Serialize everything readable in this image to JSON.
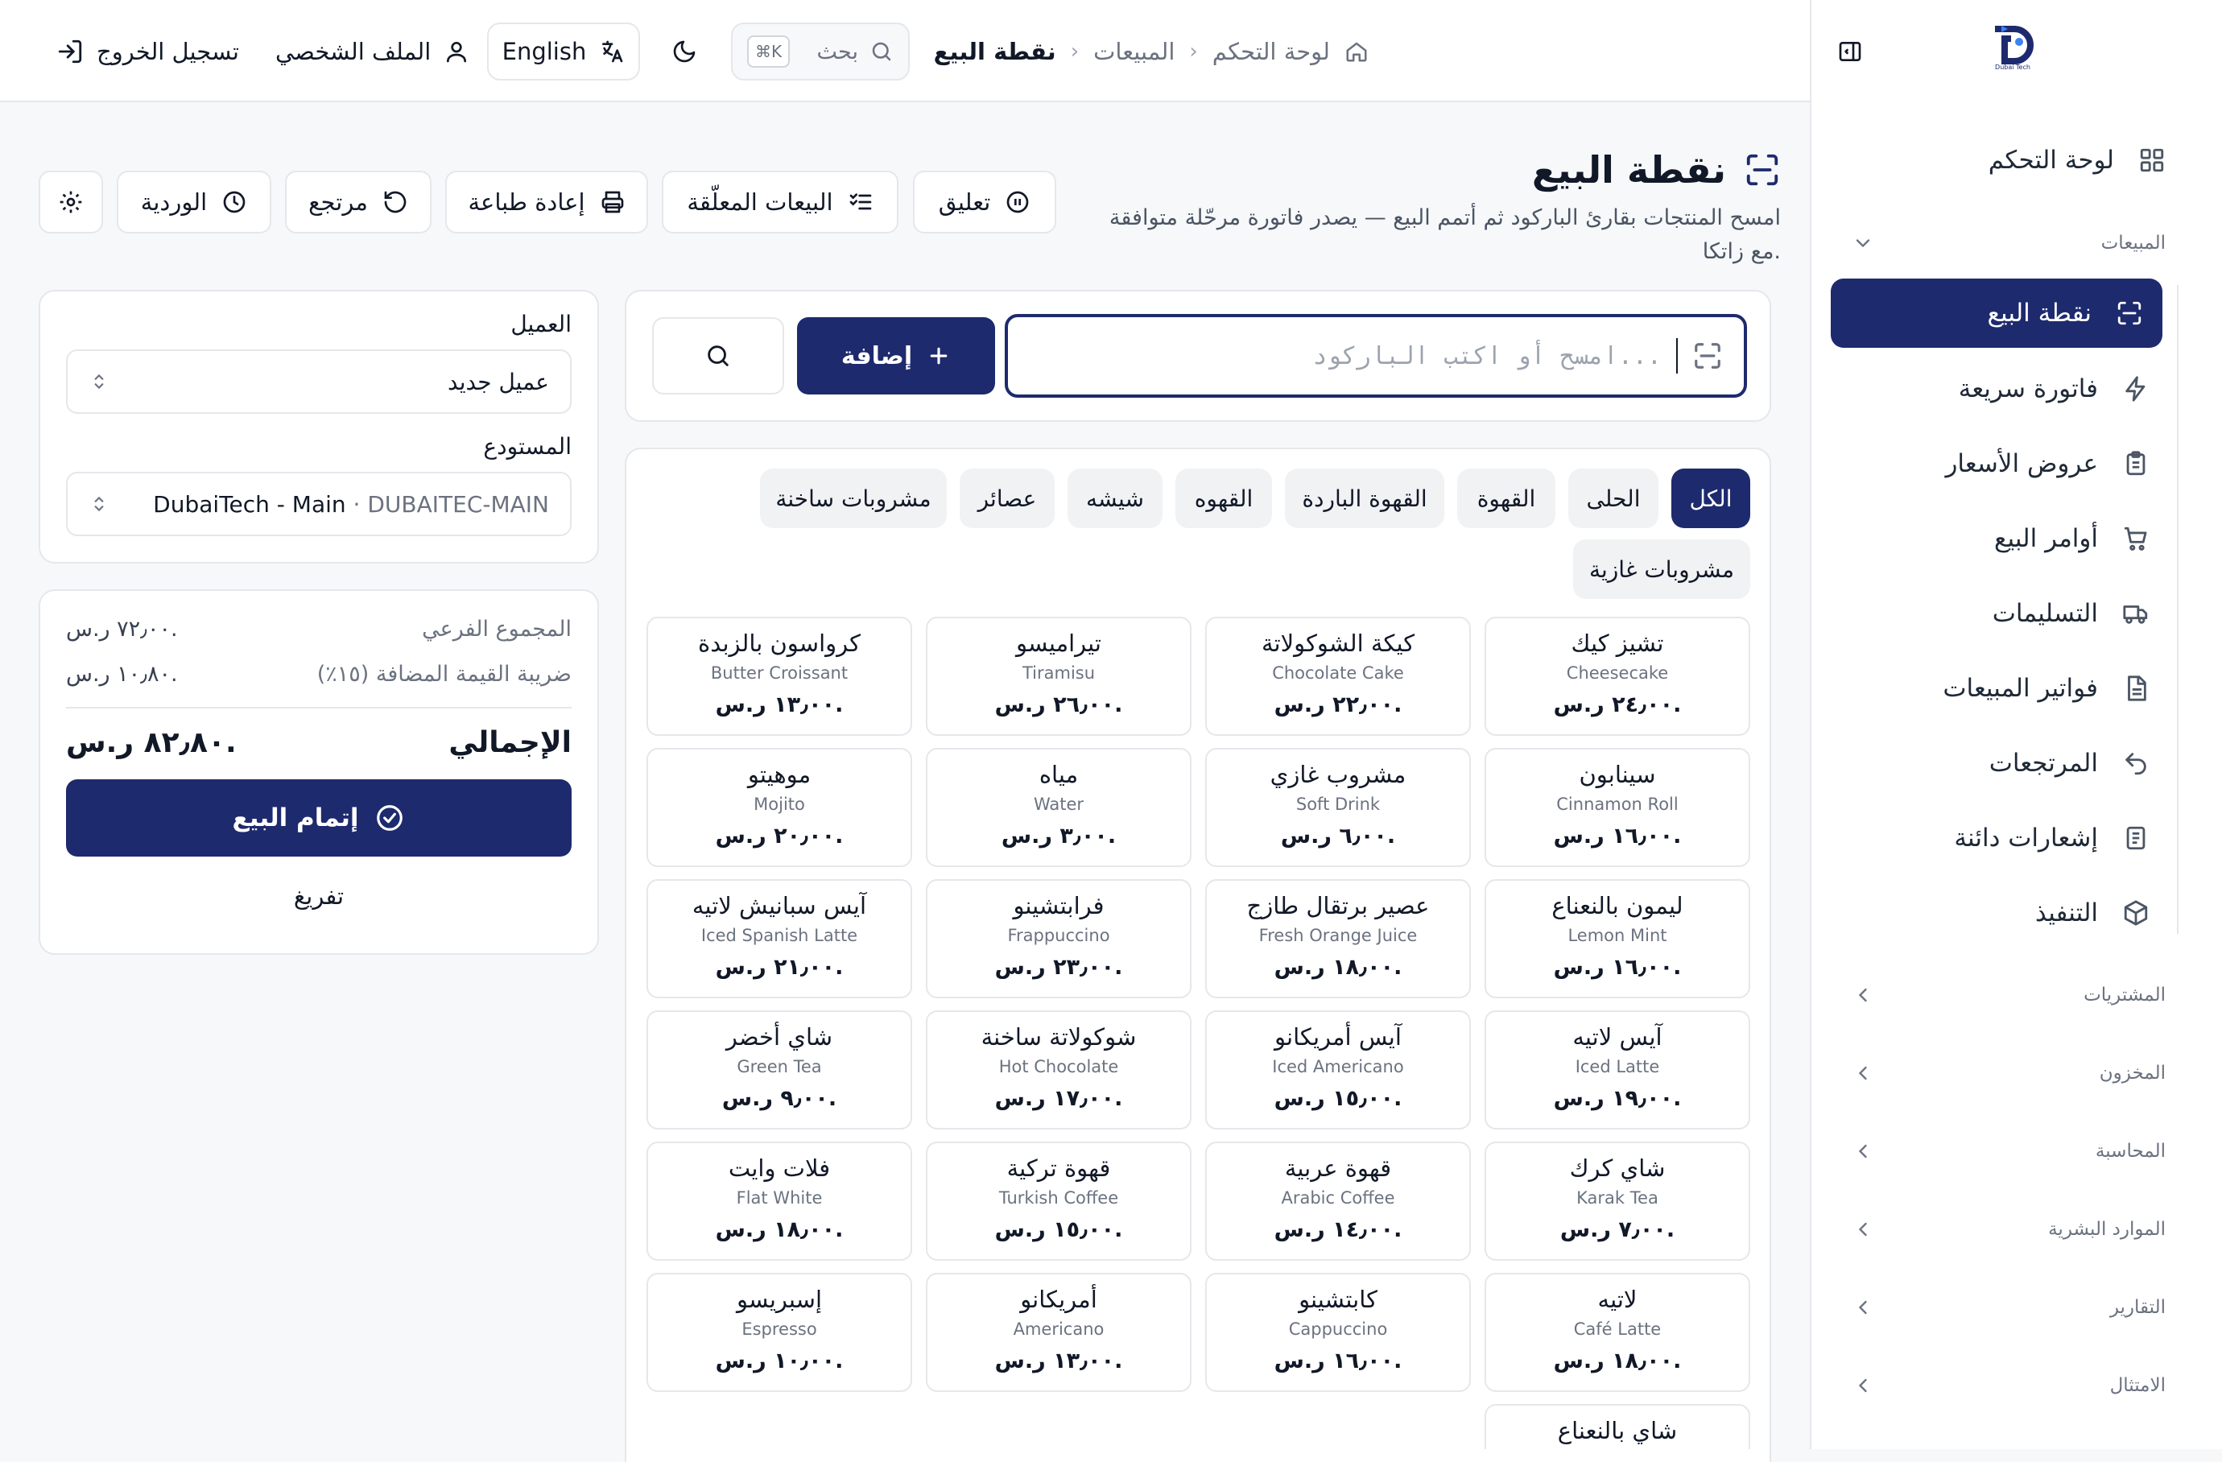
{
  "header": {
    "breadcrumb": [
      "لوحة التحكم",
      "المبيعات",
      "نقطة البيع"
    ],
    "search_placeholder": "بحث",
    "search_shortcut": "⌘K",
    "language_label": "English",
    "profile_label": "الملف الشخصي",
    "logout_label": "تسجيل الخروج"
  },
  "sidebar": {
    "logo_text": "Dubai Tech",
    "dashboard": "لوحة التحكم",
    "sales_group": "المبيعات",
    "sales_items": [
      {
        "label": "نقطة البيع",
        "icon": "scan-icon",
        "active": true
      },
      {
        "label": "فاتورة سريعة",
        "icon": "lightning-icon"
      },
      {
        "label": "عروض الأسعار",
        "icon": "clipboard-icon"
      },
      {
        "label": "أوامر البيع",
        "icon": "cart-icon"
      },
      {
        "label": "التسليمات",
        "icon": "truck-icon"
      },
      {
        "label": "فواتير المبيعات",
        "icon": "document-icon"
      },
      {
        "label": "المرتجعات",
        "icon": "undo-icon"
      },
      {
        "label": "إشعارات دائنة",
        "icon": "receipt-icon"
      },
      {
        "label": "التنفيذ",
        "icon": "box-icon"
      }
    ],
    "groups": [
      "المشتريات",
      "المخزون",
      "المحاسبة",
      "الموارد البشرية",
      "التقارير",
      "الامتثال"
    ]
  },
  "page": {
    "title": "نقطة البيع",
    "subtitle_line1": "امسح المنتجات بقارئ الباركود ثم أتمم البيع — يصدر فاتورة مرحّلة متوافقة",
    "subtitle_line2": "مع زاتكا."
  },
  "actions": {
    "suspend": "تعليق",
    "held_sales": "البيعات المعلّقة",
    "reprint": "إعادة طباعة",
    "return": "مرتجع",
    "shift": "الوردية"
  },
  "scanner": {
    "placeholder": "امسح أو اكتب الباركود...",
    "add_label": "إضافة"
  },
  "categories": [
    "الكل",
    "الحلى",
    "القهوة",
    "القهوة الباردة",
    "القهوه",
    "شيشه",
    "عصائر",
    "مشروبات ساخنة",
    "مشروبات غازية"
  ],
  "products": [
    {
      "ar": "تشيز كيك",
      "en": "Cheesecake",
      "price": "٢٤٫٠٠ ر.س."
    },
    {
      "ar": "كيكة الشوكولاتة",
      "en": "Chocolate Cake",
      "price": "٢٢٫٠٠ ر.س."
    },
    {
      "ar": "تيراميسو",
      "en": "Tiramisu",
      "price": "٢٦٫٠٠ ر.س."
    },
    {
      "ar": "كرواسون بالزبدة",
      "en": "Butter Croissant",
      "price": "١٣٫٠٠ ر.س."
    },
    {
      "ar": "سينابون",
      "en": "Cinnamon Roll",
      "price": "١٦٫٠٠ ر.س."
    },
    {
      "ar": "مشروب غازي",
      "en": "Soft Drink",
      "price": "٦٫٠٠ ر.س."
    },
    {
      "ar": "مياه",
      "en": "Water",
      "price": "٣٫٠٠ ر.س."
    },
    {
      "ar": "موهيتو",
      "en": "Mojito",
      "price": "٢٠٫٠٠ ر.س."
    },
    {
      "ar": "ليمون بالنعناع",
      "en": "Lemon Mint",
      "price": "١٦٫٠٠ ر.س."
    },
    {
      "ar": "عصير برتقال طازج",
      "en": "Fresh Orange Juice",
      "price": "١٨٫٠٠ ر.س."
    },
    {
      "ar": "فرابتشينو",
      "en": "Frappuccino",
      "price": "٢٣٫٠٠ ر.س."
    },
    {
      "ar": "آيس سبانيش لاتيه",
      "en": "Iced Spanish Latte",
      "price": "٢١٫٠٠ ر.س."
    },
    {
      "ar": "آيس لاتيه",
      "en": "Iced Latte",
      "price": "١٩٫٠٠ ر.س."
    },
    {
      "ar": "آيس أمريكانو",
      "en": "Iced Americano",
      "price": "١٥٫٠٠ ر.س."
    },
    {
      "ar": "شوكولاتة ساخنة",
      "en": "Hot Chocolate",
      "price": "١٧٫٠٠ ر.س."
    },
    {
      "ar": "شاي أخضر",
      "en": "Green Tea",
      "price": "٩٫٠٠ ر.س."
    },
    {
      "ar": "شاي كرك",
      "en": "Karak Tea",
      "price": "٧٫٠٠ ر.س."
    },
    {
      "ar": "قهوة عربية",
      "en": "Arabic Coffee",
      "price": "١٤٫٠٠ ر.س."
    },
    {
      "ar": "قهوة تركية",
      "en": "Turkish Coffee",
      "price": "١٥٫٠٠ ر.س."
    },
    {
      "ar": "فلات وايت",
      "en": "Flat White",
      "price": "١٨٫٠٠ ر.س."
    },
    {
      "ar": "لاتيه",
      "en": "Café Latte",
      "price": "١٨٫٠٠ ر.س."
    },
    {
      "ar": "كابتشينو",
      "en": "Cappuccino",
      "price": "١٦٫٠٠ ر.س."
    },
    {
      "ar": "أمريكانو",
      "en": "Americano",
      "price": "١٣٫٠٠ ر.س."
    },
    {
      "ar": "إسبريسو",
      "en": "Espresso",
      "price": "١٠٫٠٠ ر.س."
    },
    {
      "ar": "شاي بالنعناع",
      "en": "",
      "price": ""
    }
  ],
  "customer": {
    "label": "العميل",
    "value": "عميل جديد",
    "warehouse_label": "المستودع",
    "warehouse_name": "DubaiTech - Main",
    "warehouse_code": " · DUBAITEC-MAIN"
  },
  "totals": {
    "subtotal_label": "المجموع الفرعي",
    "subtotal_value": "٧٢٫٠٠ ر.س.",
    "vat_label": "ضريبة القيمة المضافة (١٥٪)",
    "vat_value": "١٠٫٨٠ ر.س.",
    "total_label": "الإجمالي",
    "total_value": "٨٢٫٨٠ ر.س.",
    "complete_label": "إتمام البيع",
    "clear_label": "تفريغ"
  },
  "colors": {
    "primary": "#1e2a6e",
    "border": "#e5e7eb",
    "muted": "#6b7280"
  }
}
